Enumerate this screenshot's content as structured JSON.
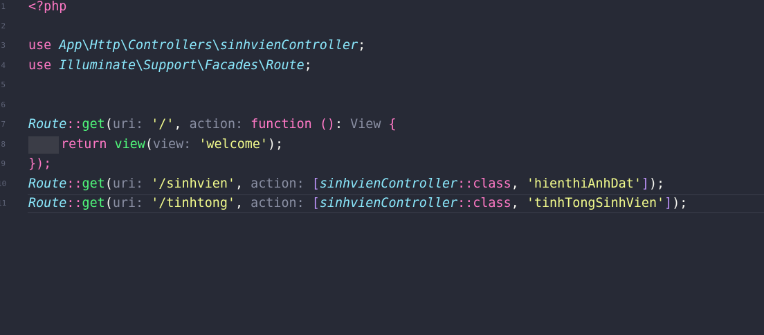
{
  "editor": {
    "line_numbers": [
      "1",
      "2",
      "3",
      "4",
      "5",
      "6",
      "7",
      "8",
      "9",
      "10",
      "11"
    ],
    "lines": {
      "l1": {
        "open_tag": "<?php"
      },
      "l3": {
        "use": "use",
        "p1": "App",
        "s1": "\\",
        "p2": "Http",
        "s2": "\\",
        "p3": "Controllers",
        "s3": "\\",
        "p4": "sinhvienController",
        "end": ";"
      },
      "l4": {
        "use": "use",
        "p1": "Illuminate",
        "s1": "\\",
        "p2": "Support",
        "s2": "\\",
        "p3": "Facades",
        "s3": "\\",
        "p4": "Route",
        "end": ";"
      },
      "l7": {
        "cls": "Route",
        "op": "::",
        "fn": "get",
        "p_open": "(",
        "hint_uri": "uri: ",
        "str": "'/'",
        "comma": ", ",
        "hint_action": "action: ",
        "kw": "function",
        "space": " ",
        "parens": "()",
        "colon": ": ",
        "type": "View",
        "brace": " {"
      },
      "l8": {
        "ret": "return",
        "fn": "view",
        "p_open": "(",
        "hint": "view: ",
        "str": "'welcome'",
        "end": ");"
      },
      "l9": {
        "close": "});"
      },
      "l10": {
        "cls": "Route",
        "op": "::",
        "fn": "get",
        "p_open": "(",
        "hint_uri": "uri: ",
        "str": "'/sinhvien'",
        "comma": ", ",
        "hint_action": "action: ",
        "b_open": "[",
        "ctrl": "sinhvienController",
        "op2": "::",
        "classkw": "class",
        "comma2": ", ",
        "method": "'hienthiAnhDat'",
        "b_close": "]",
        "end": ");"
      },
      "l11": {
        "cls": "Route",
        "op": "::",
        "fn": "get",
        "p_open": "(",
        "hint_uri": "uri: ",
        "str": "'/tinhtong'",
        "comma": ", ",
        "hint_action": "action: ",
        "b_open": "[",
        "ctrl": "sinhvienController",
        "op2": "::",
        "classkw": "class",
        "comma2": ", ",
        "method": "'tinhTongSinhVien'",
        "b_close": "]",
        "end": ");"
      }
    },
    "colors": {
      "background": "#272a36",
      "keyword": "#ff79c6",
      "class": "#8be9fd",
      "function": "#50fa7b",
      "string": "#f1fa8c",
      "hint": "#8a8fa3"
    }
  }
}
